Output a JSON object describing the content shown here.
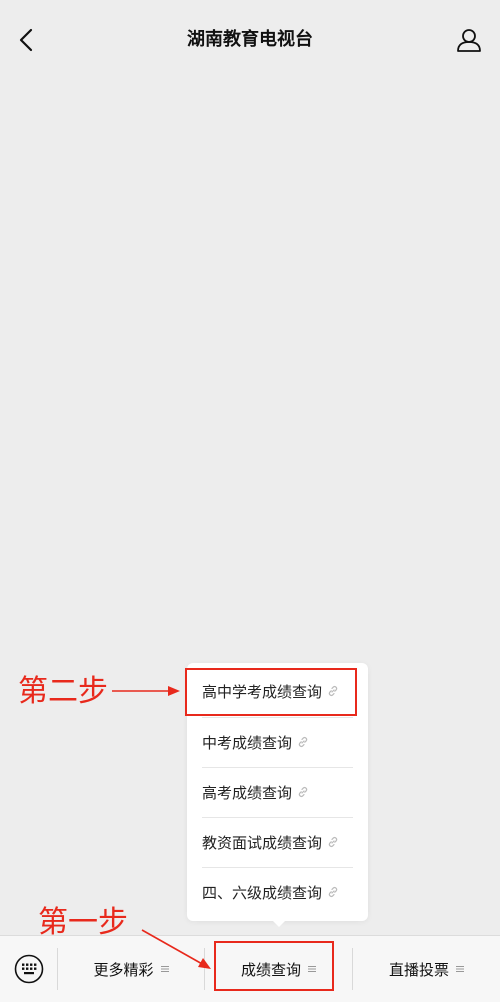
{
  "header": {
    "title": "湖南教育电视台",
    "back_icon": "chevron-left-icon",
    "user_icon": "user-icon"
  },
  "popup_menu": {
    "items": [
      {
        "label": "高中学考成绩查询",
        "icon": "link-icon"
      },
      {
        "label": "中考成绩查询",
        "icon": "link-icon"
      },
      {
        "label": "高考成绩查询",
        "icon": "link-icon"
      },
      {
        "label": "教资面试成绩查询",
        "icon": "link-icon"
      },
      {
        "label": "四、六级成绩查询",
        "icon": "link-icon"
      }
    ]
  },
  "bottom_bar": {
    "keyboard_icon": "keyboard-icon",
    "tabs": [
      {
        "label": "更多精彩",
        "icon": "menu-lines-icon"
      },
      {
        "label": "成绩查询",
        "icon": "menu-lines-icon"
      },
      {
        "label": "直播投票",
        "icon": "menu-lines-icon"
      }
    ]
  },
  "annotations": {
    "step2": "第二步",
    "step1": "第一步",
    "color": "#e8291c"
  },
  "colors": {
    "background": "#ededed",
    "popup": "#ffffff",
    "bottom_bar": "#f7f7f7",
    "annotation_red": "#e8291c"
  }
}
